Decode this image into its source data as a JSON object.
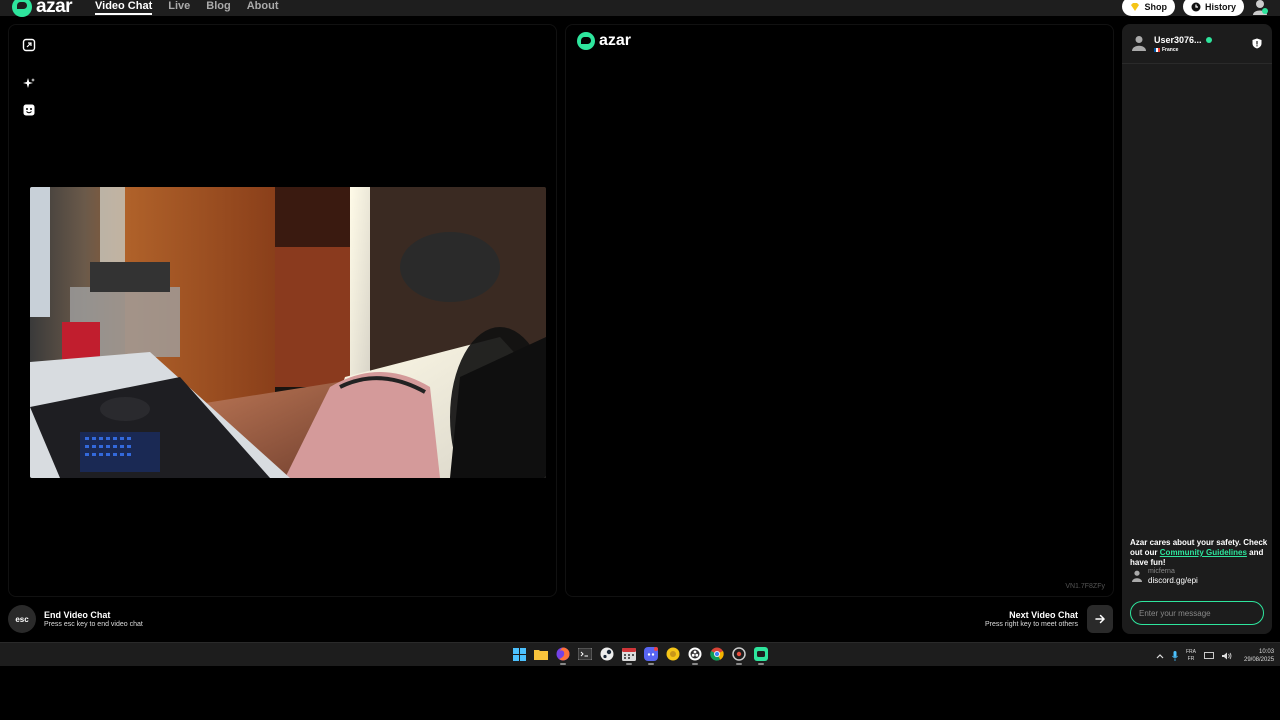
{
  "brand": {
    "name": "azar",
    "accent": "#2ee59d"
  },
  "nav": {
    "links": [
      {
        "label": "Video Chat",
        "active": true
      },
      {
        "label": "Live",
        "active": false
      },
      {
        "label": "Blog",
        "active": false
      },
      {
        "label": "About",
        "active": false
      }
    ],
    "shop_label": "Shop",
    "history_label": "History"
  },
  "partner_panel": {
    "watermark": "azar",
    "partner_id": "VN1.7F8ZFy"
  },
  "bottom_bar": {
    "esc_key": "esc",
    "end_title": "End Video Chat",
    "end_sub": "Press esc key to end video chat",
    "next_title": "Next Video Chat",
    "next_sub": "Press right key to meet others"
  },
  "chat": {
    "username": "User3076...",
    "country": "France",
    "safety_intro": "Azar cares about your safety. Check out our",
    "safety_link": "Community Guidelines",
    "safety_outro": "and have fun!",
    "messages": [
      {
        "name": "micferna",
        "text": "discord.gg/epi"
      }
    ],
    "input_placeholder": "Enter your message"
  },
  "taskbar": {
    "apps": [
      "start-icon",
      "file-explorer-icon",
      "firefox-icon",
      "terminal-icon",
      "steam-icon",
      "calendar-icon",
      "discord-icon",
      "app-yellow-icon",
      "obs-icon",
      "chrome-icon",
      "settings-icon",
      "app-green-icon"
    ],
    "lang_top": "FRA",
    "lang_bottom": "FR",
    "time": "10:03",
    "date": "29/08/2025"
  }
}
